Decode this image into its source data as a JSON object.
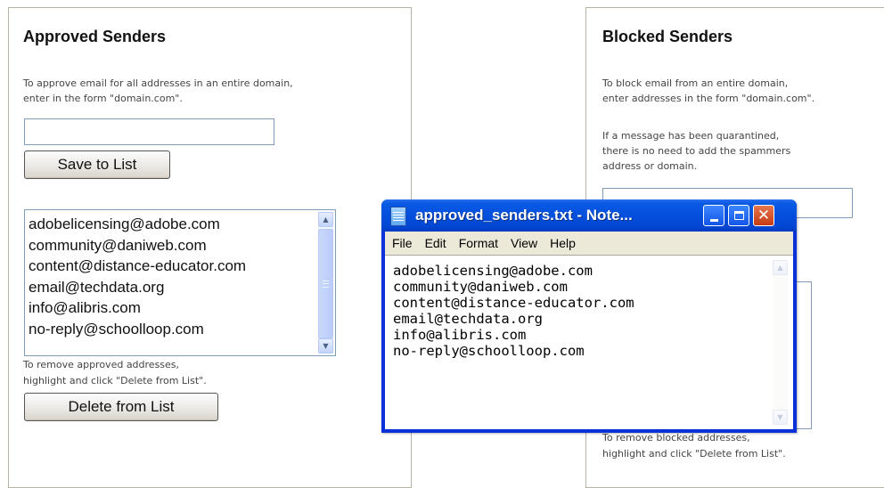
{
  "approved": {
    "title": "Approved Senders",
    "help_line1": "To approve email for all addresses in an entire domain,",
    "help_line2": "enter in the form \"domain.com\".",
    "input_value": "",
    "save_button": "Save to List",
    "list_items": [
      "adobelicensing@adobe.com",
      "community@daniweb.com",
      "content@distance-educator.com",
      "email@techdata.org",
      "info@alibris.com",
      "no-reply@schoolloop.com"
    ],
    "remove_help_line1": "To remove approved addresses,",
    "remove_help_line2": "highlight and click \"Delete from List\".",
    "delete_button": "Delete from List"
  },
  "blocked": {
    "title": "Blocked Senders",
    "help_line1": "To block email from an entire domain,",
    "help_line2": "enter addresses in the form \"domain.com\".",
    "quarantine_line1": "If a message has been quarantined,",
    "quarantine_line2": "there is no need to add the spammers",
    "quarantine_line3": "address or domain.",
    "remove_help_line1": "To remove blocked addresses,",
    "remove_help_line2": "highlight and click \"Delete from List\"."
  },
  "notepad": {
    "title": "approved_senders.txt - Note...",
    "menu": [
      "File",
      "Edit",
      "Format",
      "View",
      "Help"
    ],
    "content": "adobelicensing@adobe.com\ncommunity@daniweb.com\ncontent@distance-educator.com\nemail@techdata.org\ninfo@alibris.com\nno-reply@schoolloop.com"
  },
  "colors": {
    "title_bar": "#0552de",
    "close_button": "#c53b13",
    "menu_bar": "#ece9d8"
  }
}
